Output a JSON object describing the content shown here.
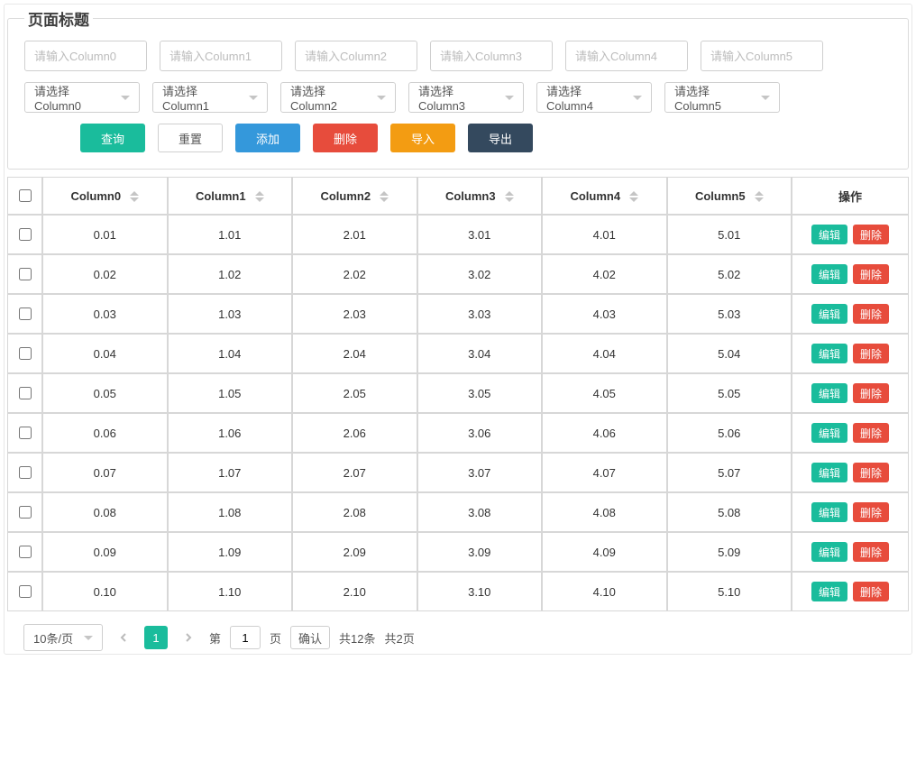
{
  "panel": {
    "legend": "页面标题"
  },
  "filters": {
    "inputs": [
      {
        "placeholder": "请输入Column0"
      },
      {
        "placeholder": "请输入Column1"
      },
      {
        "placeholder": "请输入Column2"
      },
      {
        "placeholder": "请输入Column3"
      },
      {
        "placeholder": "请输入Column4"
      },
      {
        "placeholder": "请输入Column5"
      }
    ],
    "selects": [
      {
        "label": "请选择Column0"
      },
      {
        "label": "请选择Column1"
      },
      {
        "label": "请选择Column2"
      },
      {
        "label": "请选择Column3"
      },
      {
        "label": "请选择Column4"
      },
      {
        "label": "请选择Column5"
      }
    ]
  },
  "actions": {
    "query": "查询",
    "reset": "重置",
    "add": "添加",
    "delete": "删除",
    "import": "导入",
    "export": "导出"
  },
  "table": {
    "headers": [
      "Column0",
      "Column1",
      "Column2",
      "Column3",
      "Column4",
      "Column5"
    ],
    "action_header": "操作",
    "row_edit": "编辑",
    "row_delete": "删除",
    "rows": [
      [
        "0.01",
        "1.01",
        "2.01",
        "3.01",
        "4.01",
        "5.01"
      ],
      [
        "0.02",
        "1.02",
        "2.02",
        "3.02",
        "4.02",
        "5.02"
      ],
      [
        "0.03",
        "1.03",
        "2.03",
        "3.03",
        "4.03",
        "5.03"
      ],
      [
        "0.04",
        "1.04",
        "2.04",
        "3.04",
        "4.04",
        "5.04"
      ],
      [
        "0.05",
        "1.05",
        "2.05",
        "3.05",
        "4.05",
        "5.05"
      ],
      [
        "0.06",
        "1.06",
        "2.06",
        "3.06",
        "4.06",
        "5.06"
      ],
      [
        "0.07",
        "1.07",
        "2.07",
        "3.07",
        "4.07",
        "5.07"
      ],
      [
        "0.08",
        "1.08",
        "2.08",
        "3.08",
        "4.08",
        "5.08"
      ],
      [
        "0.09",
        "1.09",
        "2.09",
        "3.09",
        "4.09",
        "5.09"
      ],
      [
        "0.10",
        "1.10",
        "2.10",
        "3.10",
        "4.10",
        "5.10"
      ]
    ]
  },
  "pager": {
    "page_size_label": "10条/页",
    "current_page": "1",
    "prefix": "第",
    "suffix": "页",
    "confirm": "确认",
    "total_items": "共12条",
    "total_pages": "共2页",
    "goto_value": "1"
  }
}
